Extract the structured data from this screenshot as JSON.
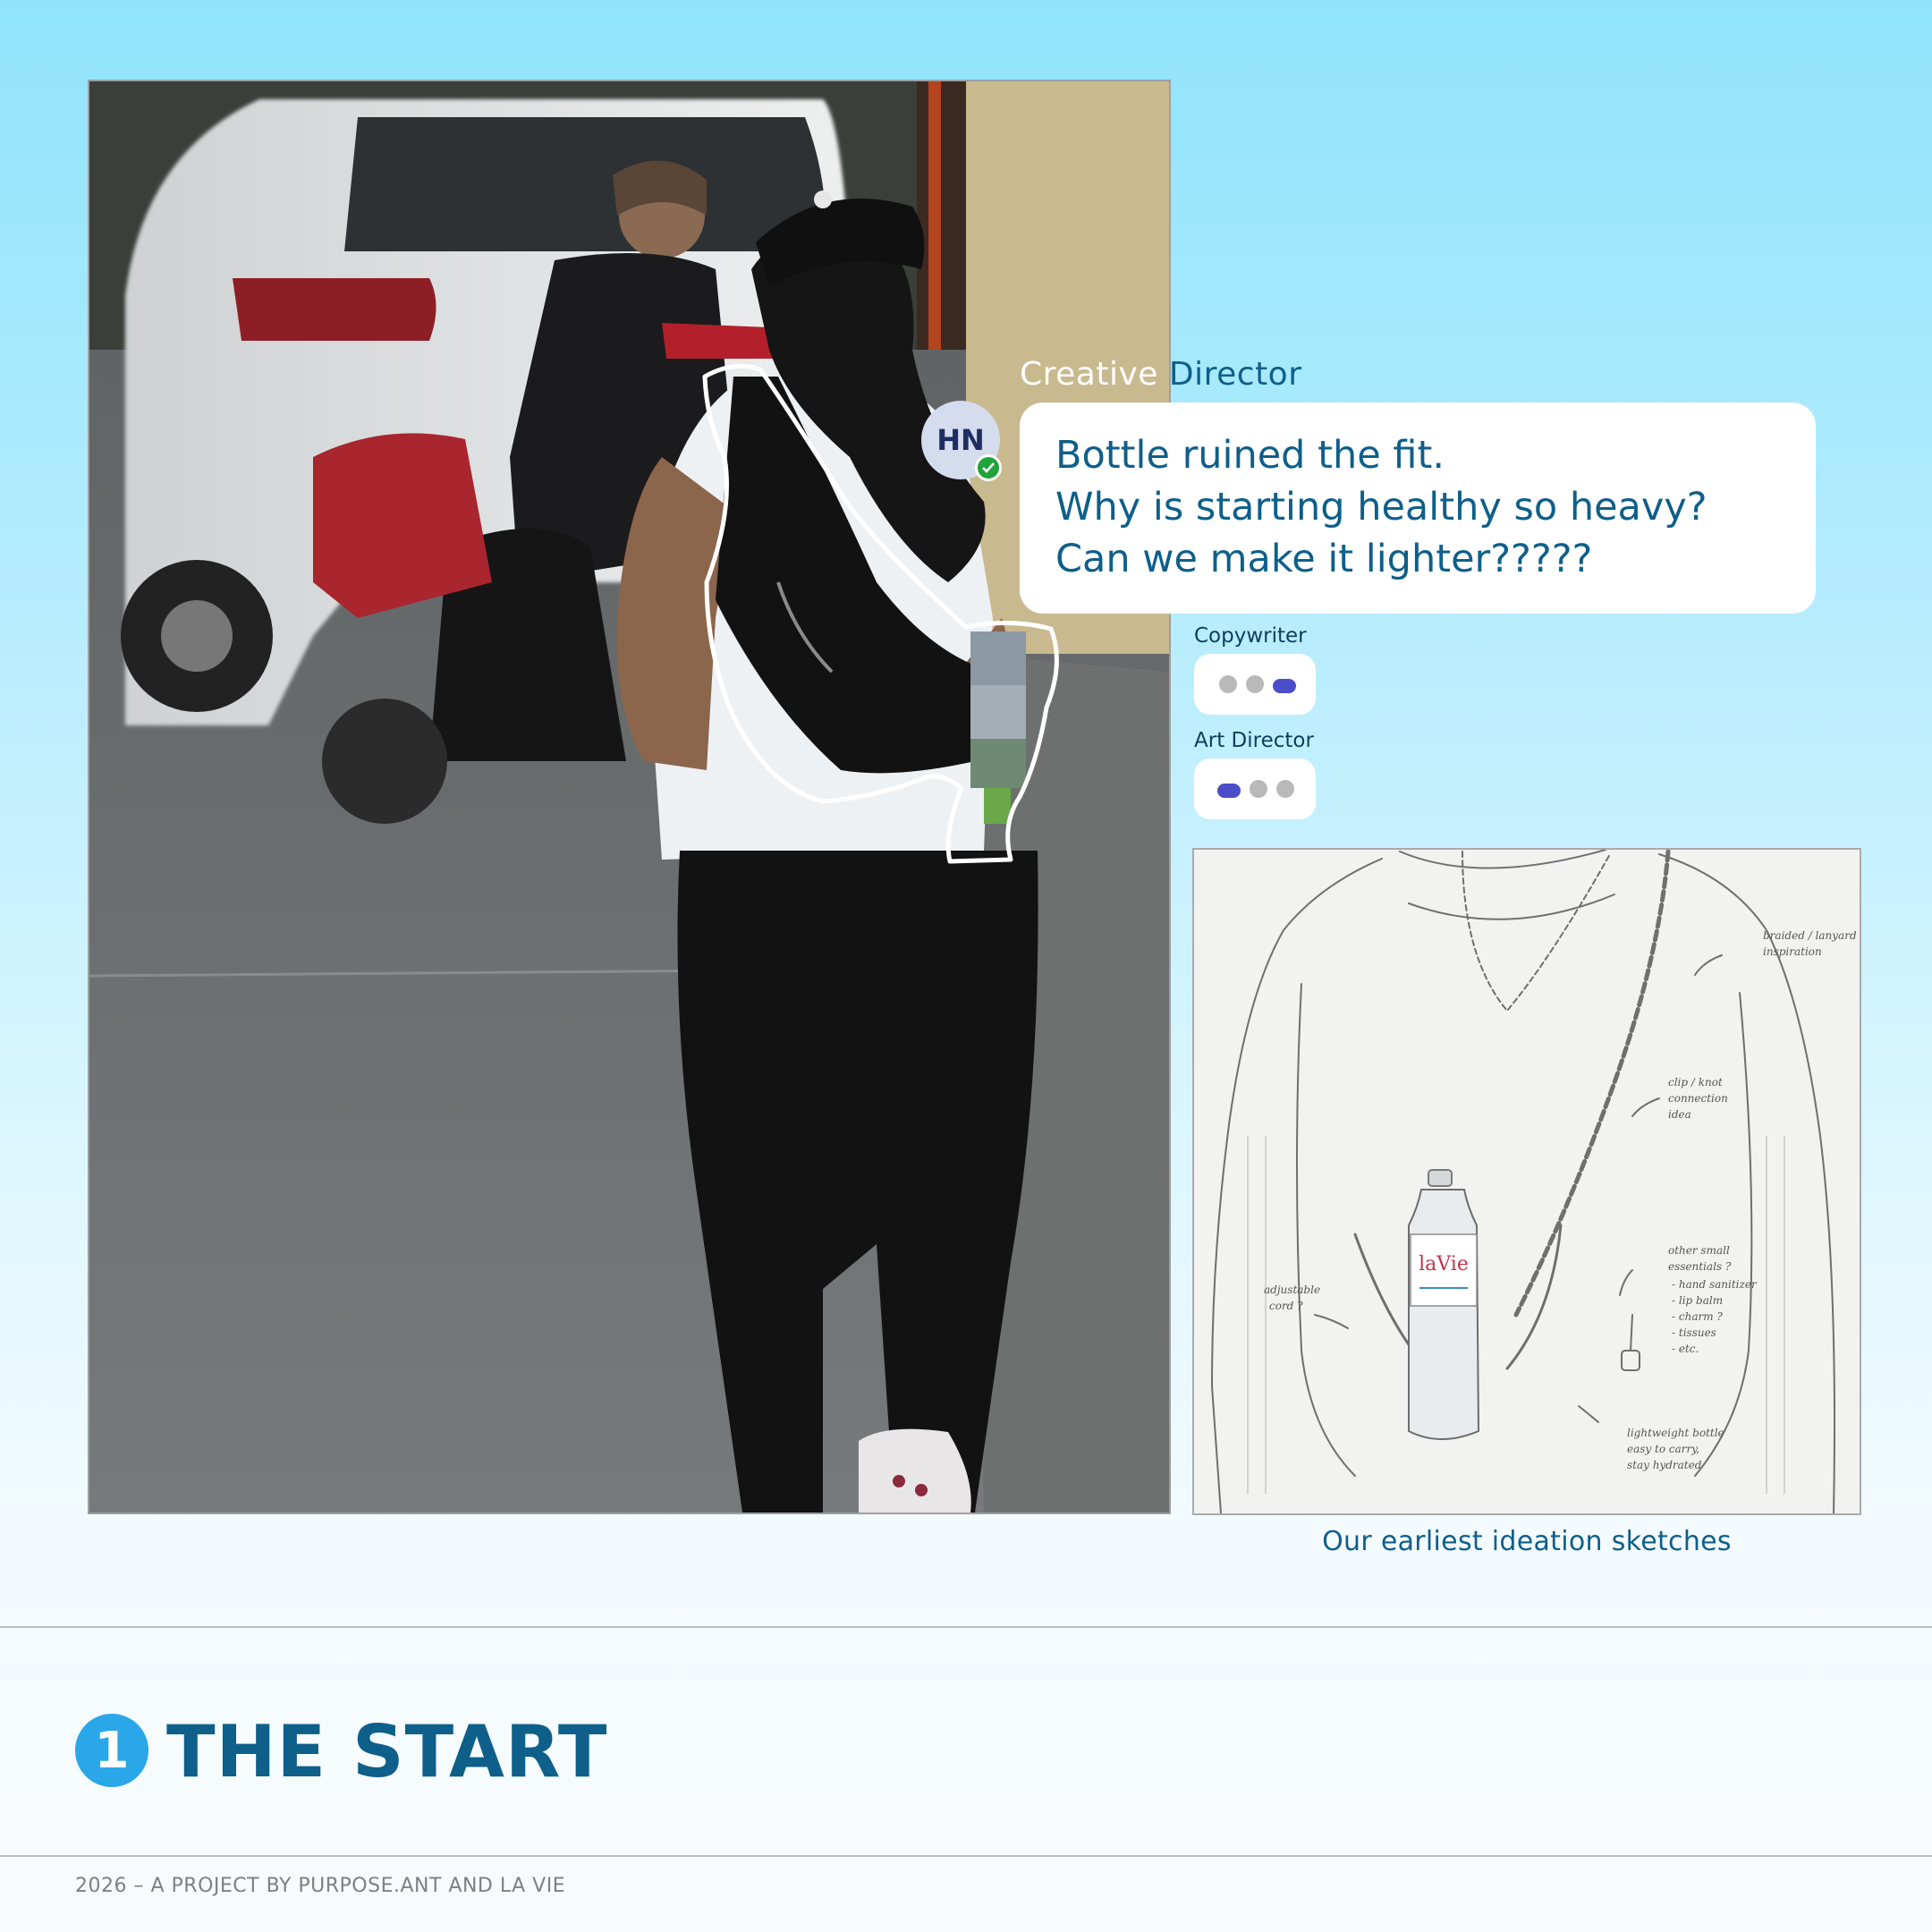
{
  "chat": {
    "role_title": {
      "word1": "Creative",
      "word2": "Director"
    },
    "avatar_initials": "HN",
    "message_lines": [
      "Bottle ruined the fit.",
      "Why is starting healthy so heavy?",
      "Can we make it lighter?????"
    ],
    "typing": [
      {
        "label": "Copywriter",
        "active_dot": 3
      },
      {
        "label": "Art Director",
        "active_dot": 1
      }
    ]
  },
  "sketch": {
    "caption": "Our earliest ideation sketches",
    "bottle_brand": "laVie",
    "notes": {
      "lanyard": [
        "braided / lanyard",
        "inspiration"
      ],
      "clip": [
        "clip / knot",
        "connection",
        "idea"
      ],
      "cord": [
        "adjustable",
        "cord ?"
      ],
      "essentials": [
        "other small",
        "essentials ?",
        "- hand sanitizer",
        "- lip balm",
        "- charm ?",
        "- tissues",
        "- etc."
      ],
      "bottle": [
        "lightweight bottle",
        "easy to carry,",
        "stay hydrated"
      ]
    }
  },
  "section": {
    "number": "1",
    "title": "THE START"
  },
  "footer": {
    "credit": "2026 – A PROJECT BY PURPOSE.ANT AND LA VIE"
  },
  "colors": {
    "accent": "#0e5f8a",
    "badge": "#2aa7e8",
    "typing_dot_active": "#4b4ec9"
  }
}
